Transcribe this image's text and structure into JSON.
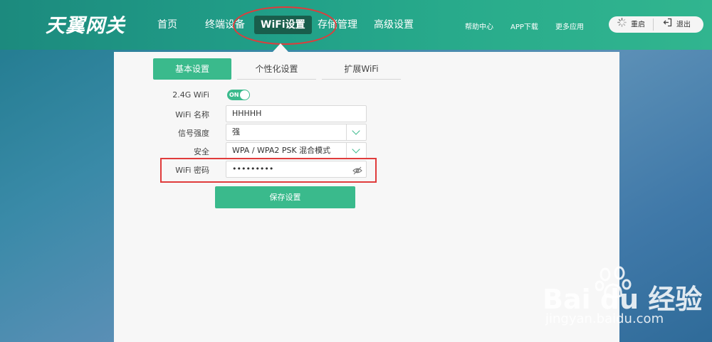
{
  "brand": {
    "logo_text": "天翼网关"
  },
  "nav": {
    "items": [
      {
        "label": "首页"
      },
      {
        "label": "终端设备"
      },
      {
        "label": "WiFi设置"
      },
      {
        "label": "存储管理"
      },
      {
        "label": "高级设置"
      }
    ],
    "active_index": 2
  },
  "utility_links": {
    "help": "帮助中心",
    "app_download": "APP下载",
    "more_apps": "更多应用"
  },
  "session": {
    "restart_label": "重启",
    "logout_label": "退出"
  },
  "tabs": {
    "items": [
      {
        "label": "基本设置"
      },
      {
        "label": "个性化设置"
      },
      {
        "label": "扩展WiFi"
      }
    ],
    "active_index": 0
  },
  "form": {
    "wifi_24g": {
      "label": "2.4G WiFi",
      "toggle_text": "ON",
      "enabled": true
    },
    "ssid": {
      "label": "WiFi 名称",
      "value": "HHHHH"
    },
    "signal": {
      "label": "信号强度",
      "value": "强"
    },
    "security": {
      "label": "安全",
      "value": "WPA / WPA2 PSK 混合模式"
    },
    "password": {
      "label": "WiFi 密码",
      "value": "•••••••••"
    },
    "save_label": "保存设置"
  },
  "watermark": {
    "brand": "Bai du 经验",
    "url": "jingyan.baidu.com"
  },
  "colors": {
    "accent": "#3aba8c",
    "nav_active": "#195e4c",
    "highlight": "#e03b3b"
  },
  "icons": {
    "restart": "spinner-icon",
    "logout": "logout-icon",
    "password_toggle": "eye-slash-icon",
    "select_arrow": "chevron-down-icon"
  }
}
